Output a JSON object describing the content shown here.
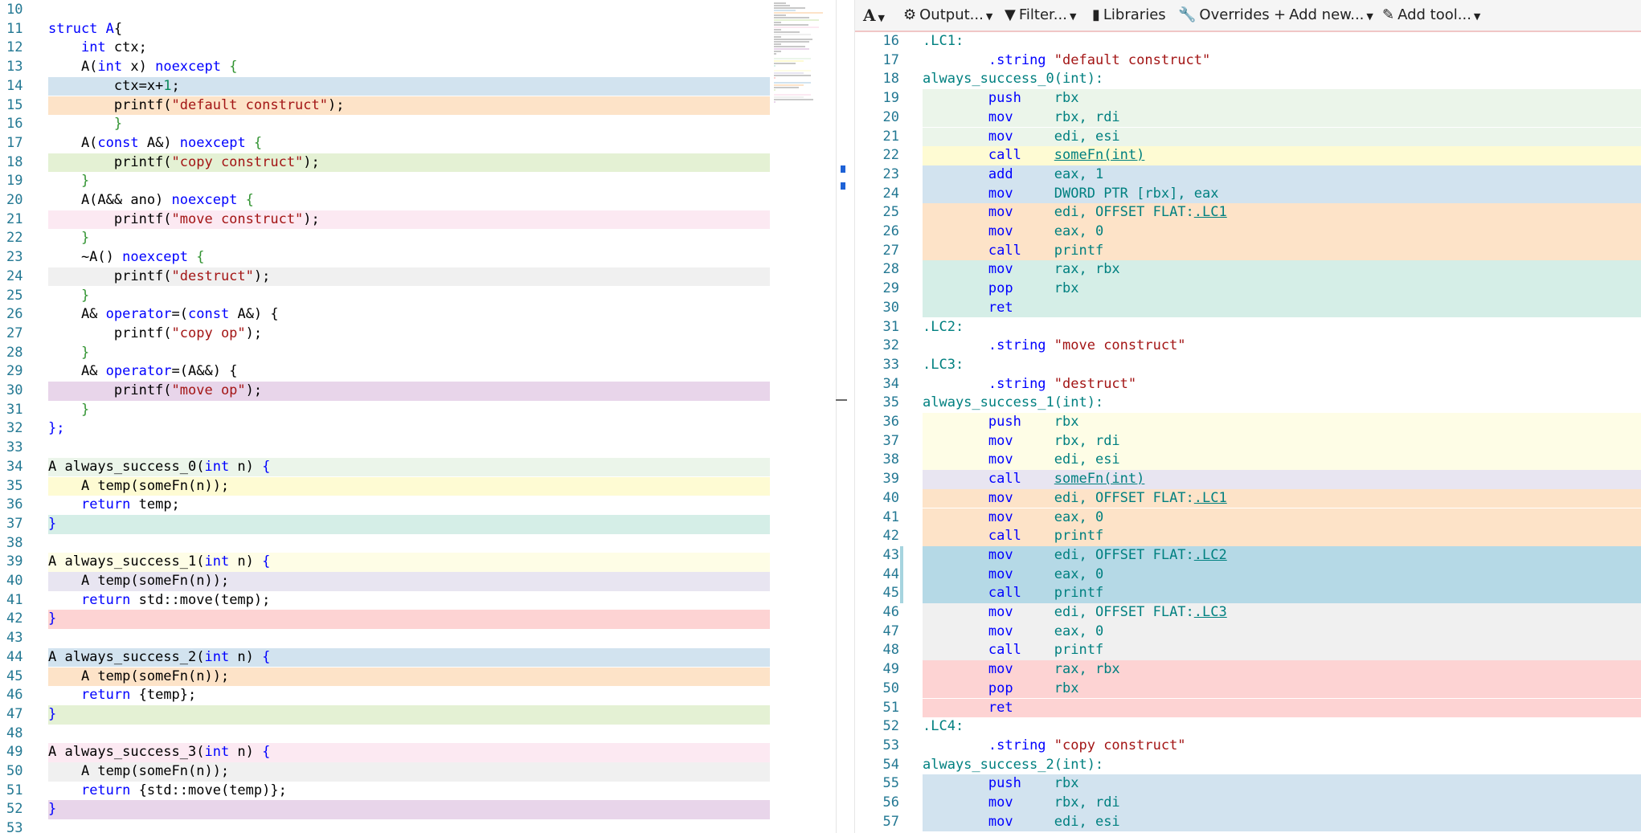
{
  "colors": {
    "blue": "#d2e3ef",
    "orange": "#fde3c8",
    "green": "#e4f1d4",
    "pink": "#fce9f2",
    "gray": "#f0f0f0",
    "purple": "#e8d5ea",
    "lightgreen": "#ebf5ea",
    "yellow": "#fefbd3",
    "teal": "#d5eee7",
    "lavender": "#e8e5f1",
    "red": "#fdd3d3",
    "cyan": "#b5d9e6",
    "lightyellow": "#fefde6"
  },
  "source_editor": {
    "lines": [
      {
        "n": "10",
        "bg": "",
        "tokens": []
      },
      {
        "n": "11",
        "bg": "",
        "tokens": [
          {
            "t": "struct A",
            "c": "#0000ff"
          },
          {
            "t": "{",
            "c": "#000"
          }
        ]
      },
      {
        "n": "12",
        "bg": "",
        "tokens": [
          {
            "t": "    ",
            "c": "#000"
          },
          {
            "t": "int",
            "c": "#0000ff"
          },
          {
            "t": " ctx;",
            "c": "#000"
          }
        ]
      },
      {
        "n": "13",
        "bg": "",
        "tokens": [
          {
            "t": "    A(",
            "c": "#000"
          },
          {
            "t": "int",
            "c": "#0000ff"
          },
          {
            "t": " x) ",
            "c": "#000"
          },
          {
            "t": "noexcept",
            "c": "#0000ff"
          },
          {
            "t": " {",
            "c": "#319331"
          }
        ]
      },
      {
        "n": "14",
        "bg": "blue",
        "tokens": [
          {
            "t": "        ctx=x+",
            "c": "#000"
          },
          {
            "t": "1",
            "c": "#098658"
          },
          {
            "t": ";",
            "c": "#000"
          }
        ]
      },
      {
        "n": "15",
        "bg": "orange",
        "tokens": [
          {
            "t": "        printf(",
            "c": "#000"
          },
          {
            "t": "\"default construct\"",
            "c": "#a31515"
          },
          {
            "t": ");",
            "c": "#000"
          }
        ]
      },
      {
        "n": "16",
        "bg": "",
        "tokens": [
          {
            "t": "        }",
            "c": "#319331"
          }
        ]
      },
      {
        "n": "17",
        "bg": "",
        "tokens": [
          {
            "t": "    A(",
            "c": "#000"
          },
          {
            "t": "const",
            "c": "#0000ff"
          },
          {
            "t": " A&) ",
            "c": "#000"
          },
          {
            "t": "noexcept",
            "c": "#0000ff"
          },
          {
            "t": " {",
            "c": "#319331"
          }
        ]
      },
      {
        "n": "18",
        "bg": "green",
        "tokens": [
          {
            "t": "        printf(",
            "c": "#000"
          },
          {
            "t": "\"copy construct\"",
            "c": "#a31515"
          },
          {
            "t": ");",
            "c": "#000"
          }
        ]
      },
      {
        "n": "19",
        "bg": "",
        "tokens": [
          {
            "t": "    }",
            "c": "#319331"
          }
        ]
      },
      {
        "n": "20",
        "bg": "",
        "tokens": [
          {
            "t": "    A(A&& ano) ",
            "c": "#000"
          },
          {
            "t": "noexcept",
            "c": "#0000ff"
          },
          {
            "t": " {",
            "c": "#319331"
          }
        ]
      },
      {
        "n": "21",
        "bg": "pink",
        "tokens": [
          {
            "t": "        printf(",
            "c": "#000"
          },
          {
            "t": "\"move construct\"",
            "c": "#a31515"
          },
          {
            "t": ");",
            "c": "#000"
          }
        ]
      },
      {
        "n": "22",
        "bg": "",
        "tokens": [
          {
            "t": "    }",
            "c": "#319331"
          }
        ]
      },
      {
        "n": "23",
        "bg": "",
        "tokens": [
          {
            "t": "    ~A() ",
            "c": "#000"
          },
          {
            "t": "noexcept",
            "c": "#0000ff"
          },
          {
            "t": " {",
            "c": "#319331"
          }
        ]
      },
      {
        "n": "24",
        "bg": "gray",
        "tokens": [
          {
            "t": "        printf(",
            "c": "#000"
          },
          {
            "t": "\"destruct\"",
            "c": "#a31515"
          },
          {
            "t": ");",
            "c": "#000"
          }
        ]
      },
      {
        "n": "25",
        "bg": "",
        "tokens": [
          {
            "t": "    }",
            "c": "#319331"
          }
        ]
      },
      {
        "n": "26",
        "bg": "",
        "tokens": [
          {
            "t": "    A& ",
            "c": "#000"
          },
          {
            "t": "operator",
            "c": "#0000ff"
          },
          {
            "t": "=(",
            "c": "#000"
          },
          {
            "t": "const",
            "c": "#0000ff"
          },
          {
            "t": " A&) {",
            "c": "#000"
          }
        ]
      },
      {
        "n": "27",
        "bg": "",
        "tokens": [
          {
            "t": "        printf(",
            "c": "#000"
          },
          {
            "t": "\"copy op\"",
            "c": "#a31515"
          },
          {
            "t": ");",
            "c": "#000"
          }
        ]
      },
      {
        "n": "28",
        "bg": "",
        "tokens": [
          {
            "t": "    }",
            "c": "#319331"
          }
        ]
      },
      {
        "n": "29",
        "bg": "",
        "tokens": [
          {
            "t": "    A& ",
            "c": "#000"
          },
          {
            "t": "operator",
            "c": "#0000ff"
          },
          {
            "t": "=(A&&) {",
            "c": "#000"
          }
        ]
      },
      {
        "n": "30",
        "bg": "purple",
        "tokens": [
          {
            "t": "        printf(",
            "c": "#000"
          },
          {
            "t": "\"move op\"",
            "c": "#a31515"
          },
          {
            "t": ");",
            "c": "#000"
          }
        ]
      },
      {
        "n": "31",
        "bg": "",
        "tokens": [
          {
            "t": "    }",
            "c": "#319331"
          }
        ]
      },
      {
        "n": "32",
        "bg": "",
        "tokens": [
          {
            "t": "};",
            "c": "#0000ff"
          }
        ]
      },
      {
        "n": "33",
        "bg": "",
        "tokens": []
      },
      {
        "n": "34",
        "bg": "lightgreen",
        "tokens": [
          {
            "t": "A always_success_0(",
            "c": "#000"
          },
          {
            "t": "int",
            "c": "#0000ff"
          },
          {
            "t": " n) ",
            "c": "#000"
          },
          {
            "t": "{",
            "c": "#0000ff"
          }
        ]
      },
      {
        "n": "35",
        "bg": "yellow",
        "tokens": [
          {
            "t": "    A temp(someFn(n));",
            "c": "#000"
          }
        ]
      },
      {
        "n": "36",
        "bg": "",
        "tokens": [
          {
            "t": "    ",
            "c": "#000"
          },
          {
            "t": "return",
            "c": "#0000ff"
          },
          {
            "t": " temp;",
            "c": "#000"
          }
        ]
      },
      {
        "n": "37",
        "bg": "teal",
        "tokens": [
          {
            "t": "}",
            "c": "#0000ff"
          }
        ]
      },
      {
        "n": "38",
        "bg": "",
        "tokens": []
      },
      {
        "n": "39",
        "bg": "lightyellow",
        "tokens": [
          {
            "t": "A always_success_1(",
            "c": "#000"
          },
          {
            "t": "int",
            "c": "#0000ff"
          },
          {
            "t": " n) ",
            "c": "#000"
          },
          {
            "t": "{",
            "c": "#0000ff"
          }
        ]
      },
      {
        "n": "40",
        "bg": "lavender",
        "tokens": [
          {
            "t": "    A temp(someFn(n));",
            "c": "#000"
          }
        ]
      },
      {
        "n": "41",
        "bg": "",
        "tokens": [
          {
            "t": "    ",
            "c": "#000"
          },
          {
            "t": "return",
            "c": "#0000ff"
          },
          {
            "t": " std::move(temp);",
            "c": "#000"
          }
        ]
      },
      {
        "n": "42",
        "bg": "red",
        "tokens": [
          {
            "t": "}",
            "c": "#0000ff"
          }
        ]
      },
      {
        "n": "43",
        "bg": "",
        "tokens": []
      },
      {
        "n": "44",
        "bg": "blue",
        "tokens": [
          {
            "t": "A always_success_2(",
            "c": "#000"
          },
          {
            "t": "int",
            "c": "#0000ff"
          },
          {
            "t": " n) ",
            "c": "#000"
          },
          {
            "t": "{",
            "c": "#0000ff"
          }
        ]
      },
      {
        "n": "45",
        "bg": "orange",
        "tokens": [
          {
            "t": "    A temp(someFn(n));",
            "c": "#000"
          }
        ]
      },
      {
        "n": "46",
        "bg": "",
        "tokens": [
          {
            "t": "    ",
            "c": "#000"
          },
          {
            "t": "return",
            "c": "#0000ff"
          },
          {
            "t": " {temp};",
            "c": "#000"
          }
        ]
      },
      {
        "n": "47",
        "bg": "green",
        "tokens": [
          {
            "t": "}",
            "c": "#0000ff"
          }
        ]
      },
      {
        "n": "48",
        "bg": "",
        "tokens": []
      },
      {
        "n": "49",
        "bg": "pink",
        "tokens": [
          {
            "t": "A always_success_3(",
            "c": "#000"
          },
          {
            "t": "int",
            "c": "#0000ff"
          },
          {
            "t": " n) ",
            "c": "#000"
          },
          {
            "t": "{",
            "c": "#0000ff"
          }
        ]
      },
      {
        "n": "50",
        "bg": "gray",
        "tokens": [
          {
            "t": "    A temp(someFn(n));",
            "c": "#000"
          }
        ]
      },
      {
        "n": "51",
        "bg": "",
        "tokens": [
          {
            "t": "    ",
            "c": "#000"
          },
          {
            "t": "return",
            "c": "#0000ff"
          },
          {
            "t": " {std::move(temp)};",
            "c": "#000"
          }
        ]
      },
      {
        "n": "52",
        "bg": "purple",
        "tokens": [
          {
            "t": "}",
            "c": "#0000ff"
          }
        ]
      },
      {
        "n": "53",
        "bg": "",
        "tokens": []
      }
    ]
  },
  "toolbar": {
    "font_label": "A",
    "output_label": "Output...",
    "filter_label": "Filter...",
    "libraries_label": "Libraries",
    "overrides_label": "Overrides",
    "add_new_label": "Add new...",
    "add_tool_label": "Add tool...",
    "icons": [
      "font-icon",
      "gear-icon",
      "filter-icon",
      "book-icon",
      "wrench-icon",
      "plus-icon",
      "tool-icon"
    ]
  },
  "assembly": {
    "lines": [
      {
        "n": "16",
        "bg": "",
        "indent": "",
        "op": "",
        "args": ".LC1:",
        "kind": "label"
      },
      {
        "n": "17",
        "bg": "",
        "indent": "        ",
        "op": ".string",
        "args": " \"default construct\"",
        "kind": "string"
      },
      {
        "n": "18",
        "bg": "",
        "indent": "",
        "op": "",
        "args": "always_success_0(int):",
        "kind": "label"
      },
      {
        "n": "19",
        "bg": "lightgreen",
        "indent": "        ",
        "op": "push",
        "args": "rbx",
        "kind": "ins"
      },
      {
        "n": "20",
        "bg": "lightgreen",
        "indent": "        ",
        "op": "mov",
        "args": "rbx, rdi",
        "kind": "ins"
      },
      {
        "n": "21",
        "bg": "lightgreen",
        "indent": "        ",
        "op": "mov",
        "args": "edi, esi",
        "kind": "ins"
      },
      {
        "n": "22",
        "bg": "yellow",
        "indent": "        ",
        "op": "call",
        "args": "someFn(int)",
        "kind": "link"
      },
      {
        "n": "23",
        "bg": "blue",
        "indent": "        ",
        "op": "add",
        "args": "eax, 1",
        "kind": "ins"
      },
      {
        "n": "24",
        "bg": "blue",
        "indent": "        ",
        "op": "mov",
        "args": "DWORD PTR [rbx], eax",
        "kind": "ins"
      },
      {
        "n": "25",
        "bg": "orange",
        "indent": "        ",
        "op": "mov",
        "args": "edi, OFFSET FLAT:",
        "ref": ".LC1",
        "kind": "ref"
      },
      {
        "n": "26",
        "bg": "orange",
        "indent": "        ",
        "op": "mov",
        "args": "eax, 0",
        "kind": "ins"
      },
      {
        "n": "27",
        "bg": "orange",
        "indent": "        ",
        "op": "call",
        "args": "printf",
        "kind": "ins"
      },
      {
        "n": "28",
        "bg": "teal",
        "indent": "        ",
        "op": "mov",
        "args": "rax, rbx",
        "kind": "ins"
      },
      {
        "n": "29",
        "bg": "teal",
        "indent": "        ",
        "op": "pop",
        "args": "rbx",
        "kind": "ins"
      },
      {
        "n": "30",
        "bg": "teal",
        "indent": "        ",
        "op": "ret",
        "args": "",
        "kind": "ins"
      },
      {
        "n": "31",
        "bg": "",
        "indent": "",
        "op": "",
        "args": ".LC2:",
        "kind": "label"
      },
      {
        "n": "32",
        "bg": "",
        "indent": "        ",
        "op": ".string",
        "args": " \"move construct\"",
        "kind": "string"
      },
      {
        "n": "33",
        "bg": "",
        "indent": "",
        "op": "",
        "args": ".LC3:",
        "kind": "label"
      },
      {
        "n": "34",
        "bg": "",
        "indent": "        ",
        "op": ".string",
        "args": " \"destruct\"",
        "kind": "string"
      },
      {
        "n": "35",
        "bg": "",
        "indent": "",
        "op": "",
        "args": "always_success_1(int):",
        "kind": "label"
      },
      {
        "n": "36",
        "bg": "lightyellow",
        "indent": "        ",
        "op": "push",
        "args": "rbx",
        "kind": "ins"
      },
      {
        "n": "37",
        "bg": "lightyellow",
        "indent": "        ",
        "op": "mov",
        "args": "rbx, rdi",
        "kind": "ins"
      },
      {
        "n": "38",
        "bg": "lightyellow",
        "indent": "        ",
        "op": "mov",
        "args": "edi, esi",
        "kind": "ins"
      },
      {
        "n": "39",
        "bg": "lavender",
        "indent": "        ",
        "op": "call",
        "args": "someFn(int)",
        "kind": "link"
      },
      {
        "n": "40",
        "bg": "orange",
        "indent": "        ",
        "op": "mov",
        "args": "edi, OFFSET FLAT:",
        "ref": ".LC1",
        "kind": "ref"
      },
      {
        "n": "41",
        "bg": "orange",
        "indent": "        ",
        "op": "mov",
        "args": "eax, 0",
        "kind": "ins"
      },
      {
        "n": "42",
        "bg": "orange",
        "indent": "        ",
        "op": "call",
        "args": "printf",
        "kind": "ins"
      },
      {
        "n": "43",
        "bg": "cyan",
        "indent": "        ",
        "op": "mov",
        "args": "edi, OFFSET FLAT:",
        "ref": ".LC2",
        "kind": "ref"
      },
      {
        "n": "44",
        "bg": "cyan",
        "indent": "        ",
        "op": "mov",
        "args": "eax, 0",
        "kind": "ins"
      },
      {
        "n": "45",
        "bg": "cyan",
        "indent": "        ",
        "op": "call",
        "args": "printf",
        "kind": "ins"
      },
      {
        "n": "46",
        "bg": "gray",
        "indent": "        ",
        "op": "mov",
        "args": "edi, OFFSET FLAT:",
        "ref": ".LC3",
        "kind": "ref"
      },
      {
        "n": "47",
        "bg": "gray",
        "indent": "        ",
        "op": "mov",
        "args": "eax, 0",
        "kind": "ins"
      },
      {
        "n": "48",
        "bg": "gray",
        "indent": "        ",
        "op": "call",
        "args": "printf",
        "kind": "ins"
      },
      {
        "n": "49",
        "bg": "red",
        "indent": "        ",
        "op": "mov",
        "args": "rax, rbx",
        "kind": "ins"
      },
      {
        "n": "50",
        "bg": "red",
        "indent": "        ",
        "op": "pop",
        "args": "rbx",
        "kind": "ins"
      },
      {
        "n": "51",
        "bg": "red",
        "indent": "        ",
        "op": "ret",
        "args": "",
        "kind": "ins"
      },
      {
        "n": "52",
        "bg": "",
        "indent": "",
        "op": "",
        "args": ".LC4:",
        "kind": "label"
      },
      {
        "n": "53",
        "bg": "",
        "indent": "        ",
        "op": ".string",
        "args": " \"copy construct\"",
        "kind": "string"
      },
      {
        "n": "54",
        "bg": "",
        "indent": "",
        "op": "",
        "args": "always_success_2(int):",
        "kind": "label"
      },
      {
        "n": "55",
        "bg": "blue",
        "indent": "        ",
        "op": "push",
        "args": "rbx",
        "kind": "ins"
      },
      {
        "n": "56",
        "bg": "blue",
        "indent": "        ",
        "op": "mov",
        "args": "rbx, rdi",
        "kind": "ins"
      },
      {
        "n": "57",
        "bg": "blue",
        "indent": "        ",
        "op": "mov",
        "args": "edi, esi",
        "kind": "ins"
      }
    ]
  }
}
